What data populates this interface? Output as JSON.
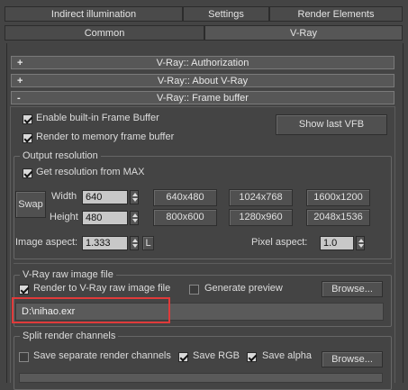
{
  "tabs_row1": [
    "Indirect illumination",
    "Settings",
    "Render Elements"
  ],
  "tabs_row2": [
    "Common",
    "V-Ray"
  ],
  "rollouts": {
    "authorization": {
      "sign": "+",
      "label": "V-Ray:: Authorization"
    },
    "about": {
      "sign": "+",
      "label": "V-Ray:: About V-Ray"
    },
    "framebuffer": {
      "sign": "-",
      "label": "V-Ray:: Frame buffer"
    }
  },
  "framebuffer": {
    "enable_builtin": "Enable built-in Frame Buffer",
    "render_to_memory": "Render to memory frame buffer",
    "show_last_vfb": "Show last VFB"
  },
  "output_resolution": {
    "title": "Output resolution",
    "get_from_max": "Get resolution from MAX",
    "swap": "Swap",
    "width_label": "Width",
    "width_value": "640",
    "height_label": "Height",
    "height_value": "480",
    "presets": [
      "640x480",
      "1024x768",
      "1600x1200",
      "800x600",
      "1280x960",
      "2048x1536"
    ],
    "image_aspect_label": "Image aspect:",
    "image_aspect_value": "1.333",
    "lock_label": "L",
    "pixel_aspect_label": "Pixel aspect:",
    "pixel_aspect_value": "1.0"
  },
  "raw_image": {
    "title": "V-Ray raw image file",
    "render_to_raw": "Render to V-Ray raw image file",
    "generate_preview": "Generate preview",
    "browse": "Browse...",
    "path": "D:\\nihao.exr"
  },
  "split_channels": {
    "title": "Split render channels",
    "save_separate": "Save separate render channels",
    "save_rgb": "Save RGB",
    "save_alpha": "Save alpha",
    "browse": "Browse..."
  },
  "colors": {
    "background": "#444444",
    "highlight": "#e03a3a"
  }
}
